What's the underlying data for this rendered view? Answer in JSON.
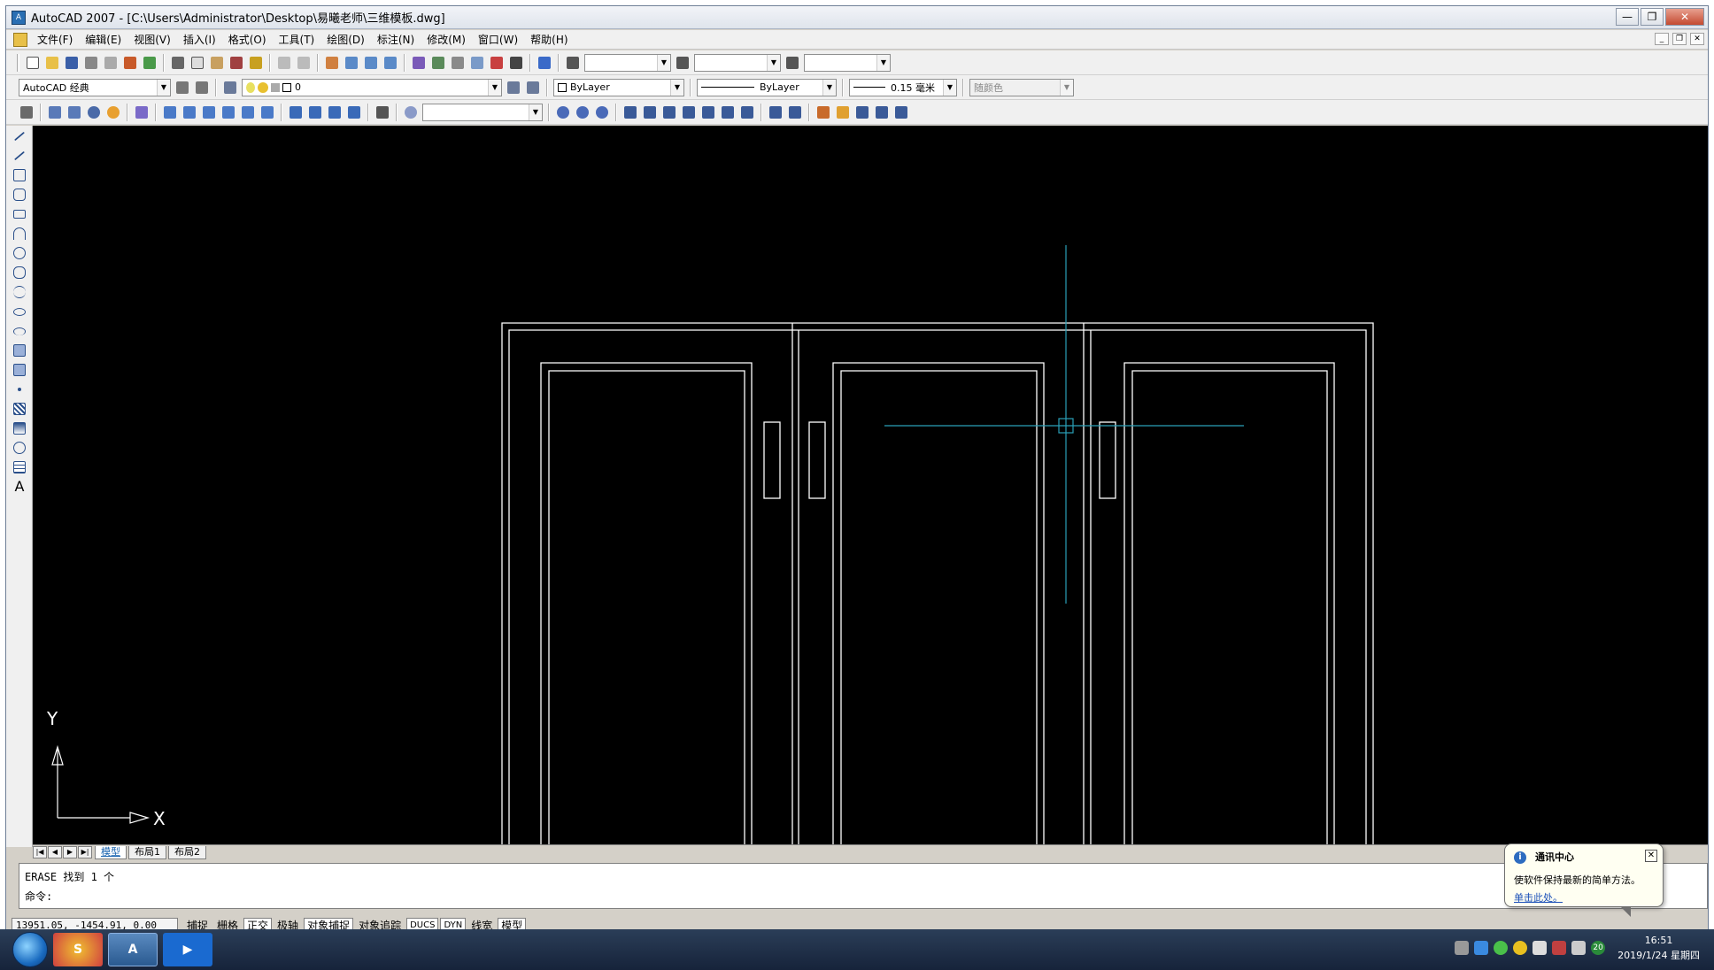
{
  "window": {
    "title": "AutoCAD 2007 - [C:\\Users\\Administrator\\Desktop\\易曦老师\\三维模板.dwg]",
    "minimize": "—",
    "restore": "❐",
    "close": "✕"
  },
  "menu": {
    "items": [
      "文件(F)",
      "编辑(E)",
      "视图(V)",
      "插入(I)",
      "格式(O)",
      "工具(T)",
      "绘图(D)",
      "标注(N)",
      "修改(M)",
      "窗口(W)",
      "帮助(H)"
    ]
  },
  "toolbar": {
    "workspace": "AutoCAD 经典",
    "layer": "0",
    "color": "ByLayer",
    "linetype": "ByLayer",
    "lineweight": "0.15 毫米",
    "plotstyle": "随颜色"
  },
  "layout_tabs": [
    "模型",
    "布局1",
    "布局2"
  ],
  "command": {
    "history": "ERASE 找到 1 个",
    "prompt": "命令:"
  },
  "status": {
    "coords": "13951.05, -1454.91, 0.00",
    "buttons": [
      "捕捉",
      "栅格",
      "正交",
      "极轴",
      "对象捕捉",
      "对象追踪",
      "DUCS",
      "DYN",
      "线宽",
      "模型"
    ],
    "on": [
      false,
      false,
      true,
      false,
      true,
      false,
      true,
      true,
      false,
      true
    ]
  },
  "balloon": {
    "title": "通讯中心",
    "message": "使软件保持最新的简单方法。",
    "link": "单击此处。"
  },
  "ucs": {
    "x": "X",
    "y": "Y"
  },
  "taskbar": {
    "badge": "20",
    "time": "16:51",
    "date": "2019/1/24 星期四"
  },
  "colors": {
    "canvas": "#000000",
    "drawing_lines": "#ffffff",
    "crosshair": "#2aa0b8"
  }
}
